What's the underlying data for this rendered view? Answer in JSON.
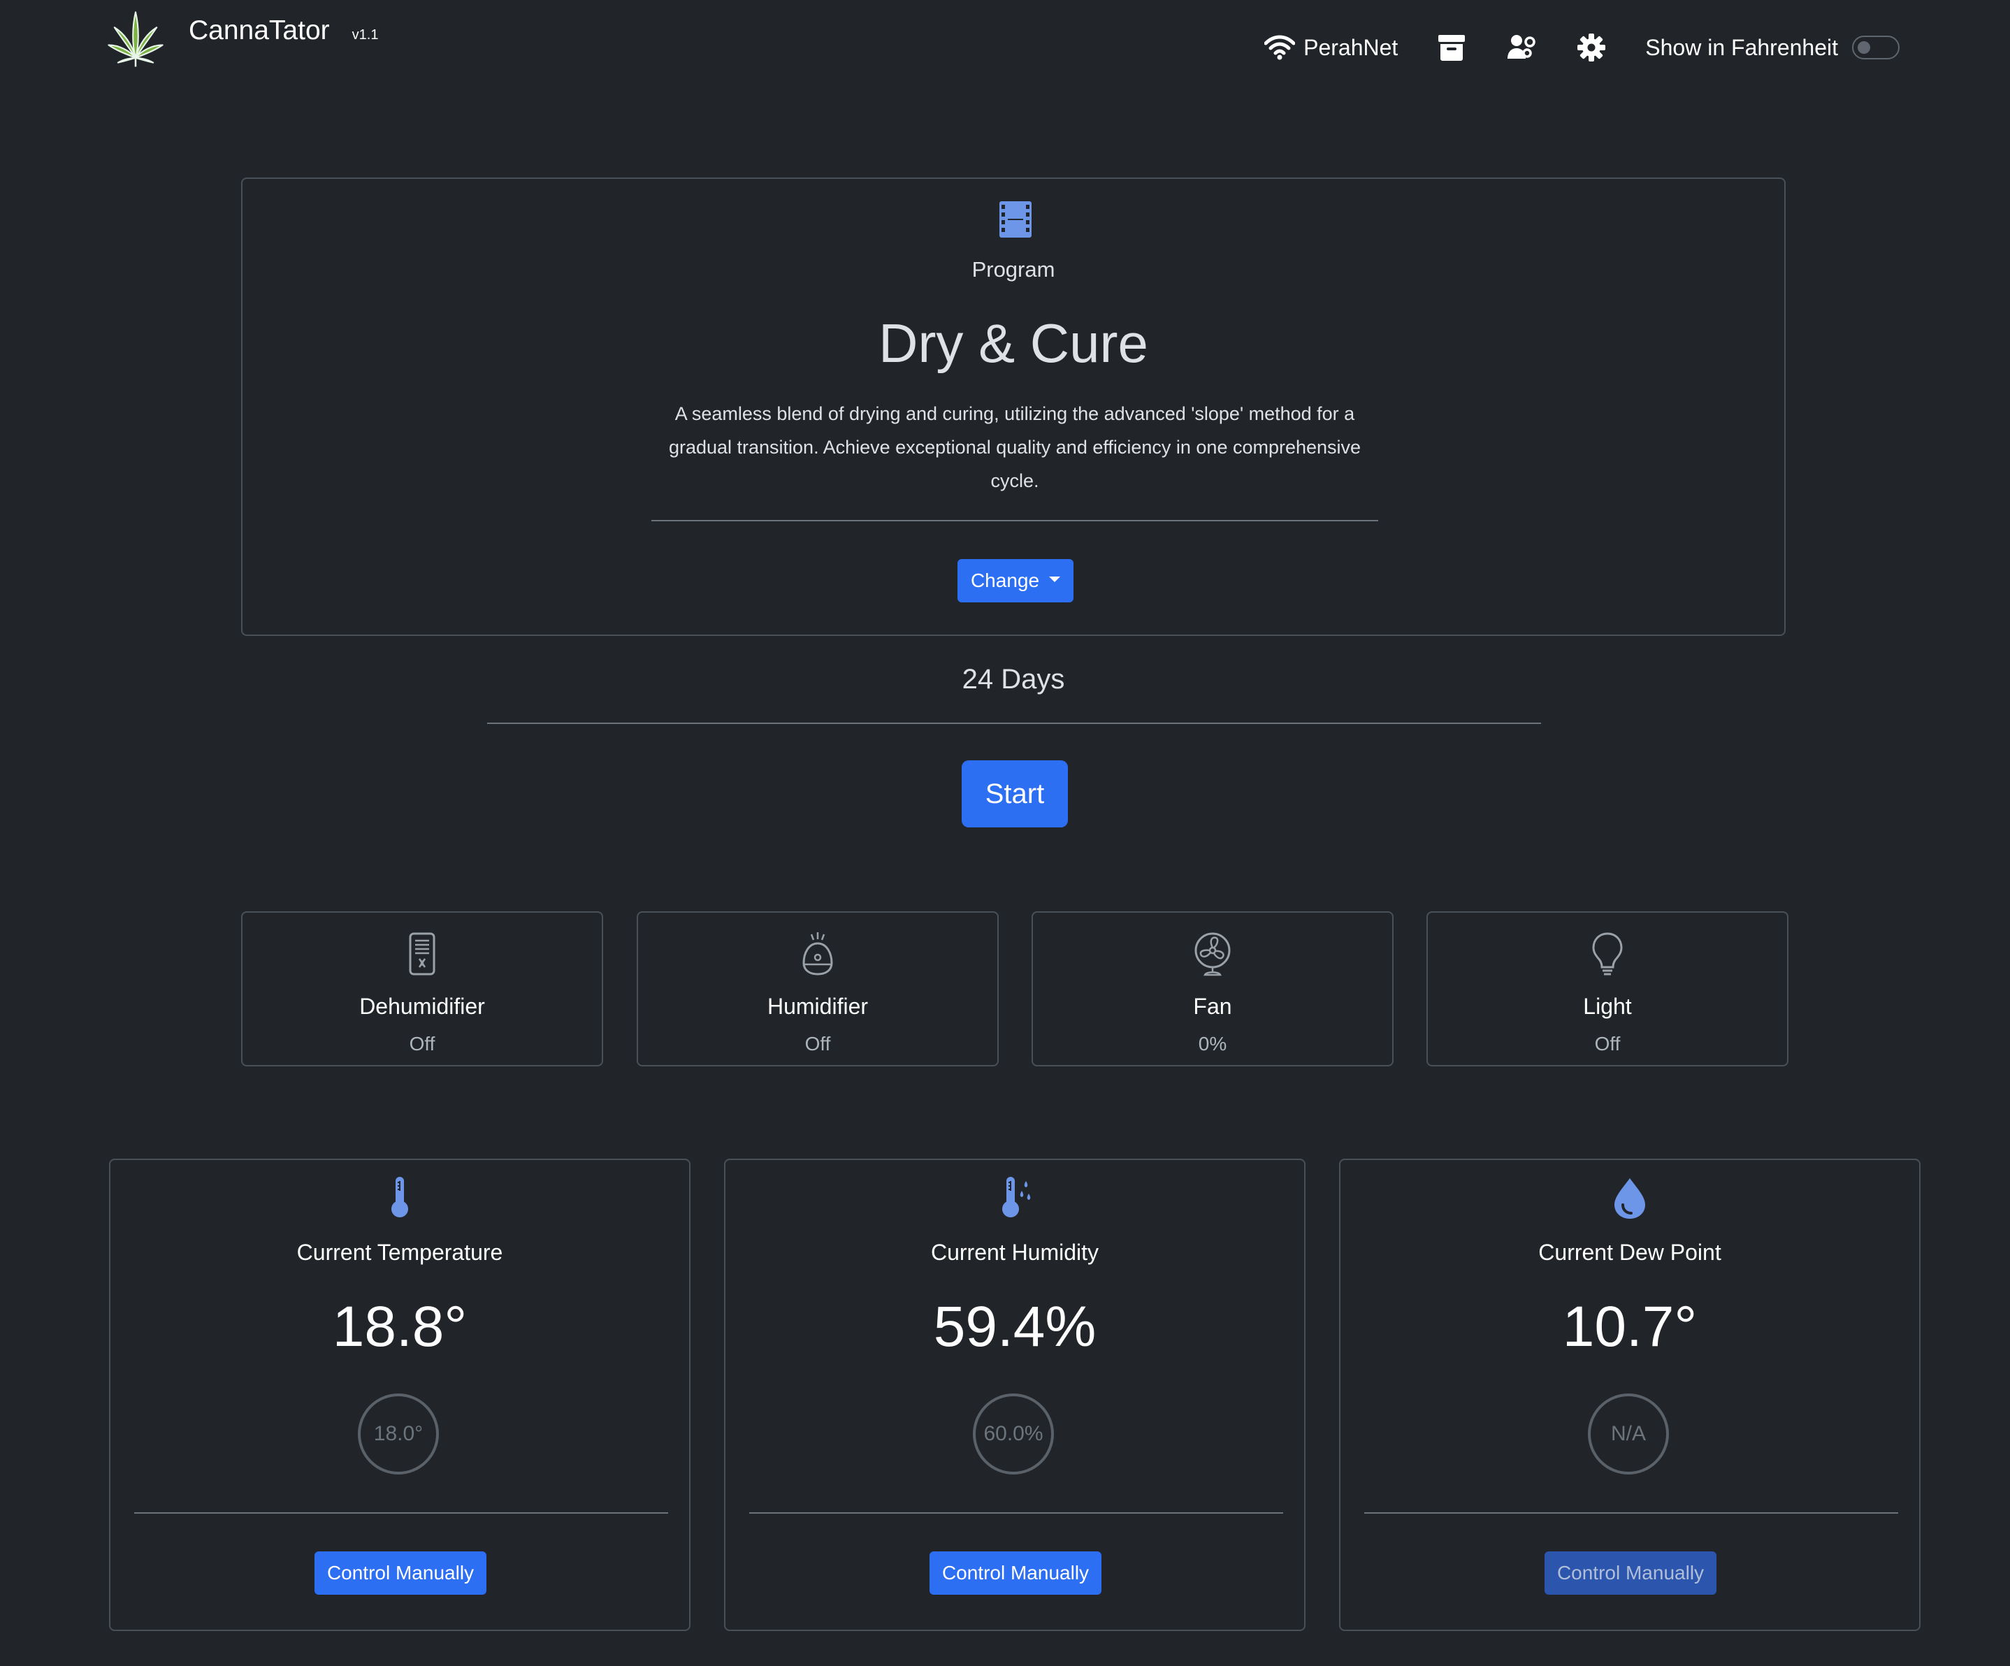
{
  "header": {
    "app_name": "CannaTator",
    "version": "v1.1",
    "wifi_name": "PerahNet",
    "fahrenheit_label": "Show in Fahrenheit",
    "fahrenheit_enabled": false
  },
  "program": {
    "section_label": "Program",
    "title": "Dry & Cure",
    "description": "A seamless blend of drying and curing, utilizing the advanced 'slope' method for a gradual transition. Achieve exceptional quality and efficiency in one comprehensive cycle.",
    "change_label": "Change"
  },
  "duration": "24 Days",
  "start_label": "Start",
  "devices": [
    {
      "name": "Dehumidifier",
      "status": "Off",
      "icon": "dehumidifier-icon"
    },
    {
      "name": "Humidifier",
      "status": "Off",
      "icon": "humidifier-icon"
    },
    {
      "name": "Fan",
      "status": "0%",
      "icon": "fan-icon"
    },
    {
      "name": "Light",
      "status": "Off",
      "icon": "lightbulb-icon"
    }
  ],
  "sensors": [
    {
      "label": "Current Temperature",
      "value": "18.8°",
      "target": "18.0°",
      "button": "Control Manually",
      "icon": "thermometer-icon",
      "enabled": true
    },
    {
      "label": "Current Humidity",
      "value": "59.4%",
      "target": "60.0%",
      "button": "Control Manually",
      "icon": "humidity-thermometer-icon",
      "enabled": true
    },
    {
      "label": "Current Dew Point",
      "value": "10.7°",
      "target": "N/A",
      "button": "Control Manually",
      "icon": "droplet-icon",
      "enabled": false
    }
  ],
  "colors": {
    "background": "#212529",
    "primary": "#2d6ff2",
    "accent_icon": "#6e96e8",
    "border": "#495057",
    "leaf": "#7cb342"
  }
}
